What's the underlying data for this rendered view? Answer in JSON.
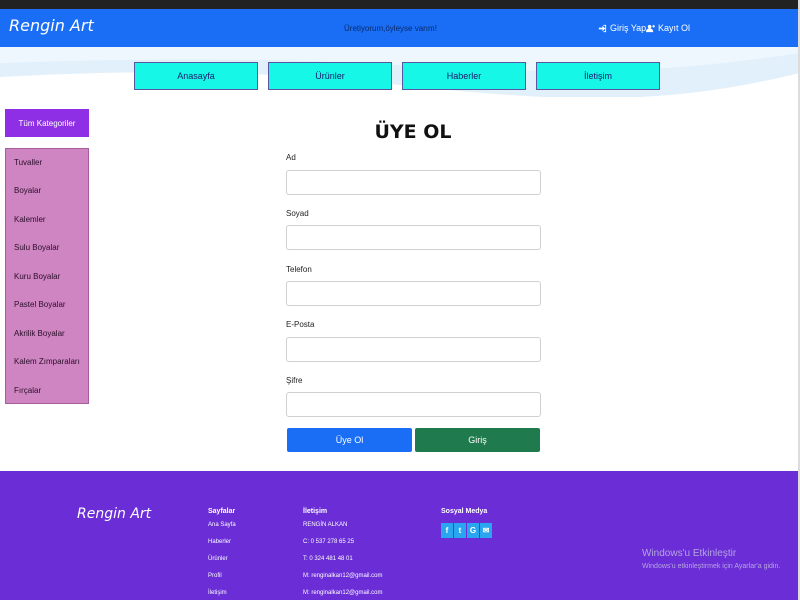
{
  "header": {
    "brand": "Rengin Art",
    "tagline": "Üretiyorum,öyleyse varım!",
    "login_label": "Giriş Yap",
    "signup_label": "Kayıt Ol"
  },
  "nav": {
    "items": [
      {
        "label": "Anasayfa"
      },
      {
        "label": "Ürünler"
      },
      {
        "label": "Haberler"
      },
      {
        "label": "İletişim"
      }
    ]
  },
  "sidebar": {
    "header": "Tüm Kategoriler",
    "items": [
      {
        "label": "Tuvaller"
      },
      {
        "label": "Boyalar"
      },
      {
        "label": "Kalemler"
      },
      {
        "label": "Sulu Boyalar"
      },
      {
        "label": "Kuru Boyalar"
      },
      {
        "label": "Pastel Boyalar"
      },
      {
        "label": "Akrilik Boyalar"
      },
      {
        "label": "Kalem Zımparaları"
      },
      {
        "label": "Fırçalar"
      }
    ]
  },
  "form": {
    "title": "ÜYE OL",
    "fields": [
      {
        "label": "Ad",
        "value": ""
      },
      {
        "label": "Soyad",
        "value": ""
      },
      {
        "label": "Telefon",
        "value": ""
      },
      {
        "label": "E-Posta",
        "value": ""
      },
      {
        "label": "Şifre",
        "value": ""
      }
    ],
    "signup_button": "Üye Ol",
    "login_button": "Giriş"
  },
  "footer": {
    "brand": "Rengin Art",
    "pages_title": "Sayfalar",
    "pages": [
      "Ana Sayfa",
      "Haberler",
      "Ürünler",
      "Profil",
      "İletişim"
    ],
    "contact_title": "İletişim",
    "contact": [
      "RENGİN ALKAN",
      "C: 0 537 278 65 25",
      "T: 0 324 481 48 01",
      "M: renginalkan12@gmail.com",
      "M: renginalkan12@gmail.com"
    ],
    "social_title": "Sosyal Medya",
    "social_icons": [
      "facebook-icon",
      "twitter-icon",
      "google-icon",
      "mail-icon"
    ]
  },
  "watermark": {
    "line1": "Windows'u Etkinleştir",
    "line2": "Windows'u etkinleştirmek için Ayarlar'a gidin."
  },
  "colors": {
    "header_blue": "#1a6ef5",
    "nav_cyan": "#17f7e8",
    "category_purple": "#8e2fe6",
    "category_pink": "#cf85c2",
    "footer_purple": "#6a2dd6",
    "login_green": "#1f7a4d"
  }
}
